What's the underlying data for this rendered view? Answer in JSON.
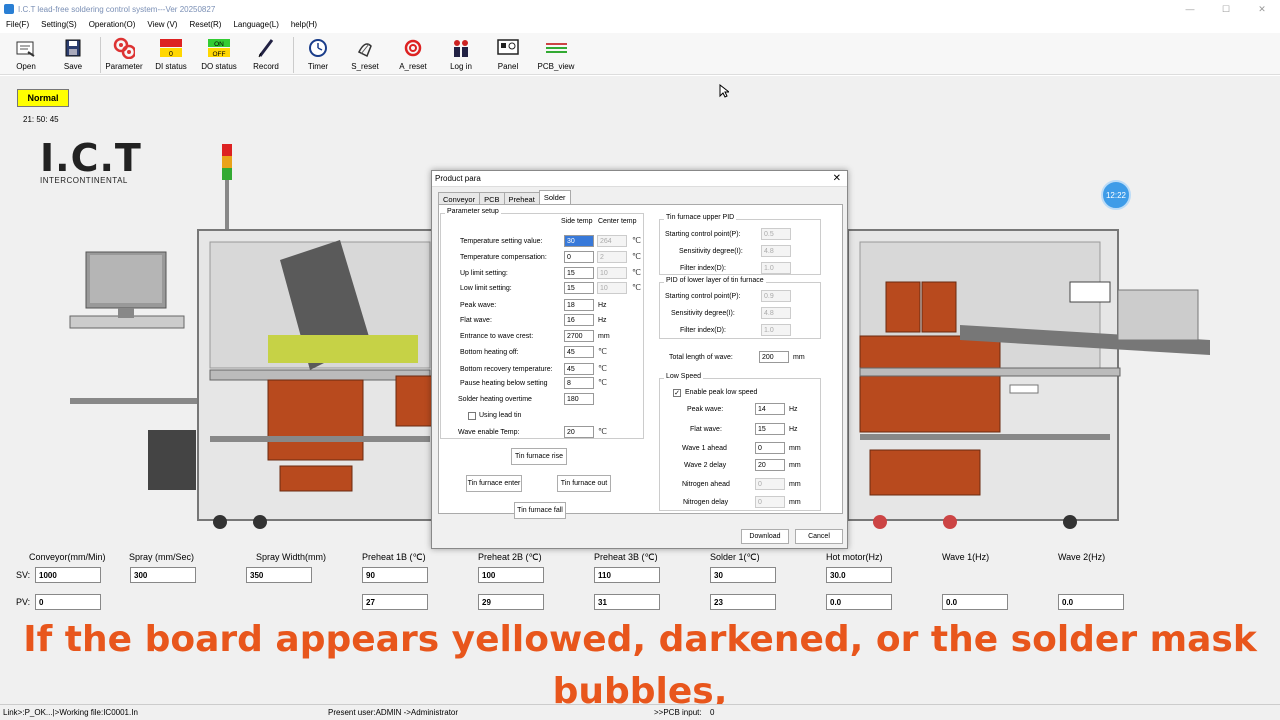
{
  "window": {
    "title": "I.C.T lead-free soldering control system---Ver 20250827",
    "minimize": "—",
    "maximize": "☐",
    "close": "✕"
  },
  "menu": [
    "File(F)",
    "Setting(S)",
    "Operation(O)",
    "View (V)",
    "Reset(R)",
    "Language(L)",
    "help(H)"
  ],
  "toolbar": {
    "open": "Open",
    "save": "Save",
    "parameter": "Parameter",
    "di_status": "DI status",
    "do_status": "DO status",
    "record": "Record",
    "timer": "Timer",
    "s_reset": "S_reset",
    "a_reset": "A_reset",
    "log_in": "Log in",
    "panel": "Panel",
    "pcb_view": "PCB_view",
    "di_value": "0",
    "do_on": "ON",
    "do_off": "OFF"
  },
  "status": {
    "mode": "Normal",
    "clock": "21: 50: 45",
    "bubble_time": "12:22"
  },
  "logo": {
    "main": "I.C.T",
    "sub": "INTERCONTINENTAL"
  },
  "dialog": {
    "title": "Product para",
    "close": "✕",
    "tabs": [
      "Conveyor",
      "PCB",
      "Preheat",
      "Solder"
    ],
    "param_setup": {
      "group_label": "Parameter setup",
      "col_side": "Side temp",
      "col_center": "Center temp",
      "temp_setting_label": "Temperature setting value:",
      "temp_setting_side": "30",
      "temp_setting_center": "264",
      "temp_comp_label": "Temperature compensation:",
      "temp_comp_side": "0",
      "temp_comp_center": "2",
      "up_limit_label": "Up limit setting:",
      "up_limit_side": "15",
      "up_limit_center": "10",
      "low_limit_label": "Low limit setting:",
      "low_limit_side": "15",
      "low_limit_center": "10",
      "peak_wave_label": "Peak wave:",
      "peak_wave_value": "18",
      "flat_wave_label": "Flat wave:",
      "flat_wave_value": "16",
      "entrance_label": "Entrance to wave crest:",
      "entrance_value": "2700",
      "bottom_off_label": "Bottom heating off:",
      "bottom_off_value": "45",
      "bottom_recovery_label": "Bottom recovery temperature:",
      "bottom_recovery_value": "45",
      "pause_label": "Pause heating below setting",
      "pause_value": "8",
      "overtime_label": "Solder heating overtime",
      "overtime_value": "180",
      "lead_tin_label": "Using lead tin",
      "wave_enable_label": "Wave enable Temp:",
      "wave_enable_value": "20",
      "unit_hz": "Hz",
      "unit_mm": "mm",
      "temp_symbol": "℃"
    },
    "upper_pid": {
      "group_label": "Tin furnace upper PID",
      "p_label": "Starting control point(P):",
      "p_value": "0.5",
      "i_label": "Sensitivity degree(I):",
      "i_value": "4.8",
      "d_label": "Filter index(D):",
      "d_value": "1.0"
    },
    "lower_pid": {
      "group_label": "PID of lower layer of tin furnace",
      "p_label": "Starting control point(P):",
      "p_value": "0.9",
      "i_label": "Sensitivity degree(I):",
      "i_value": "4.8",
      "d_label": "Filter index(D):",
      "d_value": "1.0"
    },
    "total_wave_label": "Total length of wave:",
    "total_wave_value": "200",
    "low_speed": {
      "group_label": "Low Speed",
      "enable_label": "Enable peak low speed",
      "peak_label": "Peak wave:",
      "peak_value": "14",
      "flat_label": "Flat wave:",
      "flat_value": "15",
      "wave1_label": "Wave 1 ahead",
      "wave1_value": "0",
      "wave2_label": "Wave 2 delay",
      "wave2_value": "20",
      "n2_ahead_label": "Nitrogen ahead",
      "n2_ahead_value": "0",
      "n2_delay_label": "Nitrogen delay",
      "n2_delay_value": "0"
    },
    "buttons": {
      "rise": "Tin furnace rise",
      "enter": "Tin furnace enter",
      "out": "Tin furnace out",
      "fall": "Tin furnace fall",
      "download": "Download",
      "cancel": "Cancel"
    }
  },
  "params": {
    "headers": [
      "Conveyor(mm/Min)",
      "Spray (mm/Sec)",
      "Spray Width(mm)",
      "Preheat 1B (℃)",
      "Preheat 2B (℃)",
      "Preheat 3B (℃)",
      "Solder 1(℃)",
      "Hot motor(Hz)",
      "Wave 1(Hz)",
      "Wave 2(Hz)"
    ],
    "sv_label": "SV:",
    "pv_label": "PV:",
    "sv": [
      "1000",
      "300",
      "350",
      "90",
      "100",
      "110",
      "30",
      "30.0"
    ],
    "pv": [
      "0",
      "27",
      "29",
      "31",
      "23",
      "0.0",
      "0.0",
      "0.0"
    ]
  },
  "subtitle": {
    "line1": "If the board appears yellowed, darkened, or the solder mask",
    "line2": "bubbles,"
  },
  "statusbar": {
    "left": "Link>:P_OK...|>Working file:IC0001.In",
    "user": "Present user:ADMIN ->Administrator",
    "pcb": ">>PCB input:",
    "pcb_value": "0"
  },
  "colors": {
    "accent": "#3e9ce8",
    "subtitle": "#e8561c",
    "normal": "#ffff00",
    "machine_red": "#b84a1e"
  }
}
